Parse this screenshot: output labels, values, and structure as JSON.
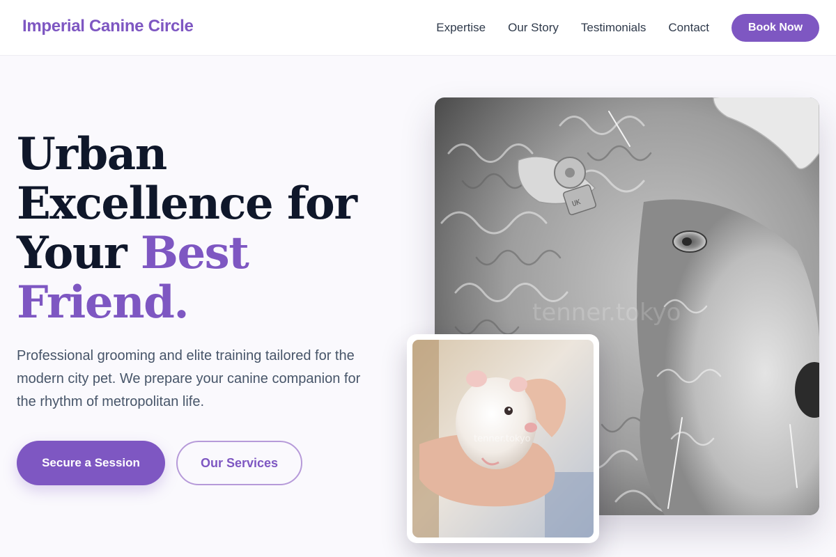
{
  "brand": {
    "name": "Imperial Canine Circle"
  },
  "nav": {
    "links": [
      "Expertise",
      "Our Story",
      "Testimonials",
      "Contact"
    ],
    "cta_label": "Book Now"
  },
  "hero": {
    "headline_line1": "Urban",
    "headline_line2": "Excellence for",
    "headline_line3_plain": "Your ",
    "headline_line3_accent": "Best",
    "headline_line4_accent": "Friend.",
    "subtitle": "Professional grooming and elite training tailored for the modern city pet. We prepare your canine companion for the rhythm of metropolitan life.",
    "primary_cta": "Secure a Session",
    "secondary_cta": "Our Services"
  },
  "images": {
    "main_alt": "Close-up of a curly-wool sheep's face",
    "inset_alt": "Small white hamster held in a hand",
    "main_watermark": "tenner.tokyo",
    "inset_watermark": "tenner.tokyo",
    "ear_tag_text": "UK"
  },
  "colors": {
    "brand_purple": "#7e57c2",
    "outline_purple": "#b69ad9",
    "heading_navy": "#0f172a",
    "body_slate": "#475569",
    "page_bg": "#faf9fd"
  }
}
